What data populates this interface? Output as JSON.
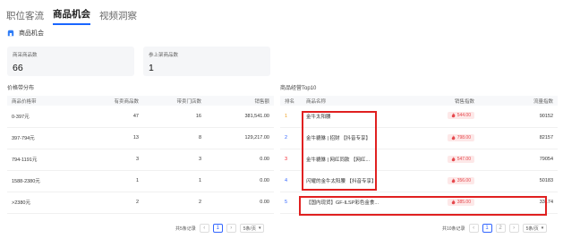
{
  "tabs": [
    {
      "label": "职位客流"
    },
    {
      "label": "商品机会"
    },
    {
      "label": "视频洞察"
    }
  ],
  "section": {
    "title": "商品机会"
  },
  "stats": [
    {
      "label": "商采商品数",
      "value": "66"
    },
    {
      "label": "参上架商品数",
      "value": "1"
    }
  ],
  "left": {
    "title": "价格带分布",
    "headers": [
      "商品价格带",
      "有卖商品数",
      "带卖门店数",
      "销售额"
    ],
    "rows": [
      [
        "0-397元",
        "47",
        "16",
        "381,541.00"
      ],
      [
        "397-794元",
        "13",
        "8",
        "129,217.00"
      ],
      [
        "794-1191元",
        "3",
        "3",
        "0.00"
      ],
      [
        "1588-2380元",
        "1",
        "1",
        "0.00"
      ],
      [
        ">2380元",
        "2",
        "2",
        "0.00"
      ]
    ],
    "pager": {
      "total": "共5条记录",
      "page": "1",
      "size": "5条/页"
    }
  },
  "right": {
    "title": "商品经营Top10",
    "headers": [
      "排名",
      "商品名称",
      "销售指数",
      "流量指数"
    ],
    "rows": [
      {
        "rank": "1",
        "name": "金牛太阳腰",
        "price": "544.00",
        "traffic": "90152"
      },
      {
        "rank": "2",
        "name": "金牛貔貅 | 招财 【抖音专享】",
        "price": "798.00",
        "traffic": "82157"
      },
      {
        "rank": "3",
        "name": "金牛貔貅 | 网红同款 【网红...",
        "price": "547.00",
        "traffic": "79054"
      },
      {
        "rank": "4",
        "name": "闪耀的金牛太阳腰 【抖音专享】",
        "price": "356.00",
        "traffic": "50183"
      },
      {
        "rank": "5",
        "name": "【国内现货】GF-ILSP彩色金食...",
        "price": "385.00",
        "traffic": "33174"
      }
    ],
    "pager": {
      "total": "共10条记录",
      "pages": [
        "1",
        "2"
      ],
      "size": "5条/页"
    }
  },
  "colors": {
    "accent": "#1a66ff",
    "highlight": "#e02020",
    "price_bg": "#fde8e8"
  }
}
